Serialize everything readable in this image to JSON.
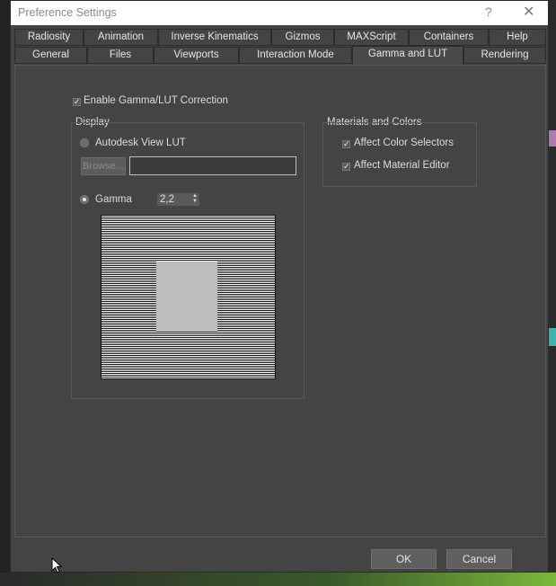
{
  "dialog": {
    "title": "Preference Settings",
    "help_glyph": "?",
    "close_glyph": "✕"
  },
  "tabs_row1": [
    "Radiosity",
    "Animation",
    "Inverse Kinematics",
    "Gizmos",
    "MAXScript",
    "Containers",
    "Help"
  ],
  "tabs_row2": [
    "General",
    "Files",
    "Viewports",
    "Interaction Mode",
    "Gamma and LUT",
    "Rendering"
  ],
  "active_tab": "Gamma and LUT",
  "enable_gamma": {
    "label": "Enable Gamma/LUT Correction",
    "checked": true
  },
  "display": {
    "label": "Display",
    "lut_label": "Autodesk View LUT",
    "lut_selected": false,
    "browse_label": "Browse...",
    "lut_path": "",
    "gamma_label": "Gamma",
    "gamma_selected": true,
    "gamma_value": "2,2"
  },
  "materials": {
    "label": "Materials and Colors",
    "color_selectors": {
      "label": "Affect Color Selectors",
      "checked": true
    },
    "material_editor": {
      "label": "Affect Material Editor",
      "checked": true
    }
  },
  "buttons": {
    "ok": "OK",
    "cancel": "Cancel"
  },
  "colors": {
    "dialog_bg": "#444444",
    "titlebar_bg": "#ffffff"
  }
}
